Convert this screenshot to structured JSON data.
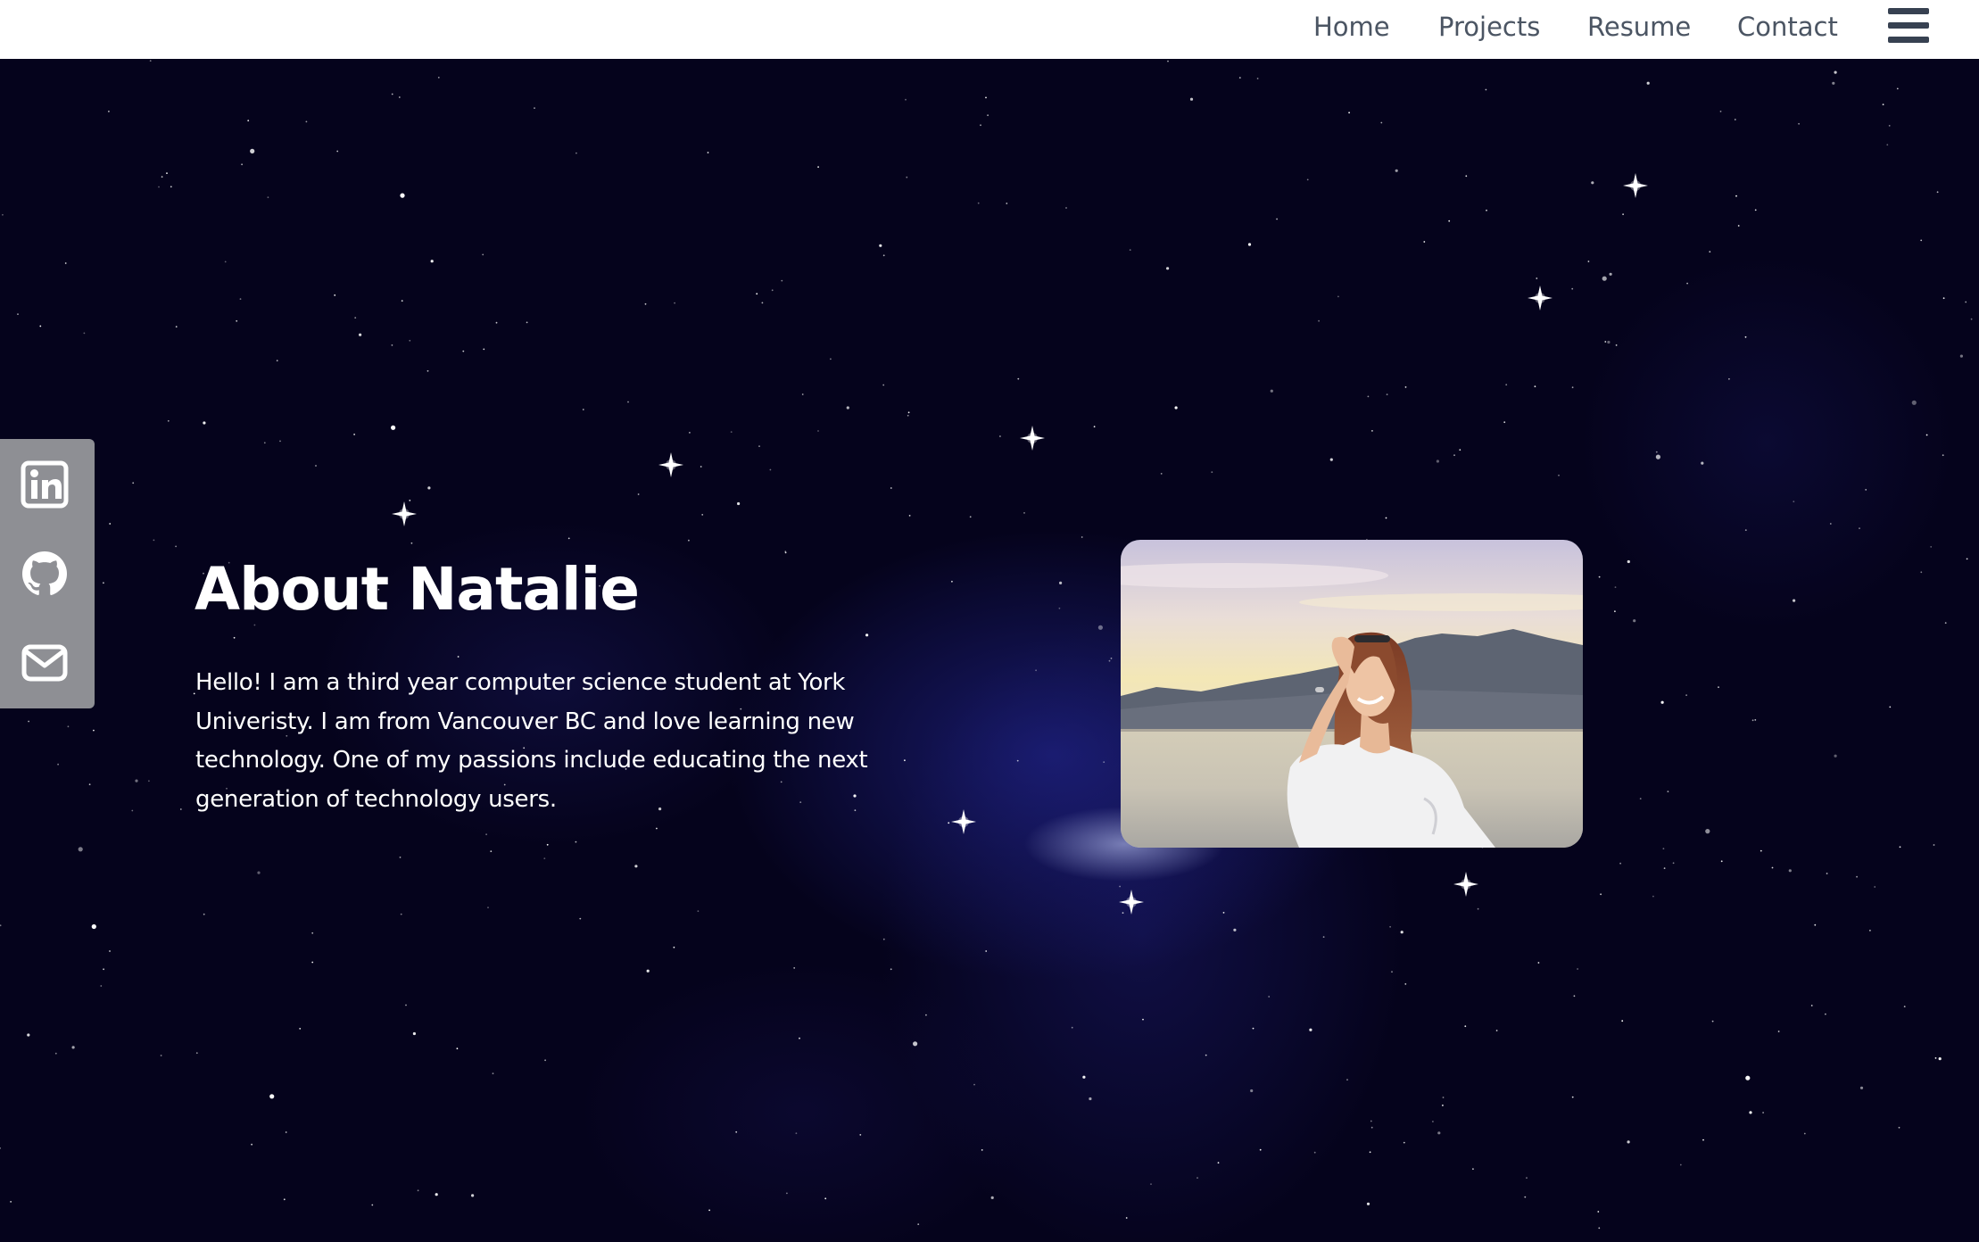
{
  "nav": {
    "home": "Home",
    "projects": "Projects",
    "resume": "Resume",
    "contact": "Contact",
    "menu_icon": "hamburger-menu-icon"
  },
  "social": {
    "items": [
      {
        "icon": "linkedin-icon"
      },
      {
        "icon": "github-icon"
      },
      {
        "icon": "email-icon"
      }
    ]
  },
  "about": {
    "title": "About Natalie",
    "text": "Hello! I am a third year computer science student at York Univeristy. I am from Vancouver BC and love learning new technology. One of my passions include educating the next generation of technology users."
  },
  "colors": {
    "nav_bg": "#ffffff",
    "nav_text": "#4b5563",
    "page_bg": "#05031c",
    "sidebar_bg": "#8e8f94",
    "icon_color": "#ffffff"
  }
}
